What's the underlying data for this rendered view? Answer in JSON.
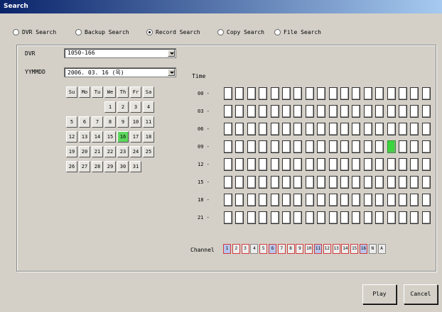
{
  "window": {
    "title": "Search"
  },
  "modes": [
    {
      "label": "DVR Search",
      "selected": false
    },
    {
      "label": "Backup Search",
      "selected": false
    },
    {
      "label": "Record Search",
      "selected": true
    },
    {
      "label": "Copy Search",
      "selected": false
    },
    {
      "label": "File Search",
      "selected": false
    }
  ],
  "filters": {
    "dvr_label": "DVR",
    "dvr_value": "1050-166",
    "date_label": "YYMMDD",
    "date_value": "2006. 03. 16  (목)"
  },
  "calendar": {
    "weekdays": [
      "Su",
      "Mo",
      "Tu",
      "We",
      "Th",
      "Fr",
      "Sa"
    ],
    "weeks": [
      [
        "",
        "",
        "",
        "1",
        "2",
        "3",
        "4"
      ],
      [
        "5",
        "6",
        "7",
        "8",
        "9",
        "10",
        "11"
      ],
      [
        "12",
        "13",
        "14",
        "15",
        "16",
        "17",
        "18"
      ],
      [
        "19",
        "20",
        "21",
        "22",
        "23",
        "24",
        "25"
      ],
      [
        "26",
        "27",
        "28",
        "29",
        "30",
        "31",
        ""
      ]
    ],
    "selected_day": "16"
  },
  "timeline": {
    "label": "Time",
    "row_labels": [
      "00 -",
      "03 -",
      "06 -",
      "09 -",
      "12 -",
      "15 -",
      "18 -",
      "21 -"
    ],
    "columns": 18,
    "recorded_cells": [
      [
        3,
        14
      ]
    ]
  },
  "channels": {
    "label": "Channel",
    "items": [
      "1",
      "2",
      "3",
      "4",
      "5",
      "6",
      "7",
      "8",
      "9",
      "10",
      "11",
      "12",
      "13",
      "14",
      "15",
      "16",
      "N",
      "A"
    ],
    "blue": [
      "1",
      "6",
      "11",
      "16"
    ],
    "red_border": [
      "1",
      "2",
      "3",
      "5",
      "6",
      "7",
      "8",
      "9",
      "10",
      "11",
      "12",
      "13",
      "14",
      "15",
      "16"
    ]
  },
  "buttons": {
    "play": "Play",
    "cancel": "Cancel"
  },
  "colors": {
    "selected": "#5cd65c",
    "recorded": "#3bd63b",
    "channel_blue": "#b8c4ec",
    "channel_red": "#d23c3c"
  }
}
